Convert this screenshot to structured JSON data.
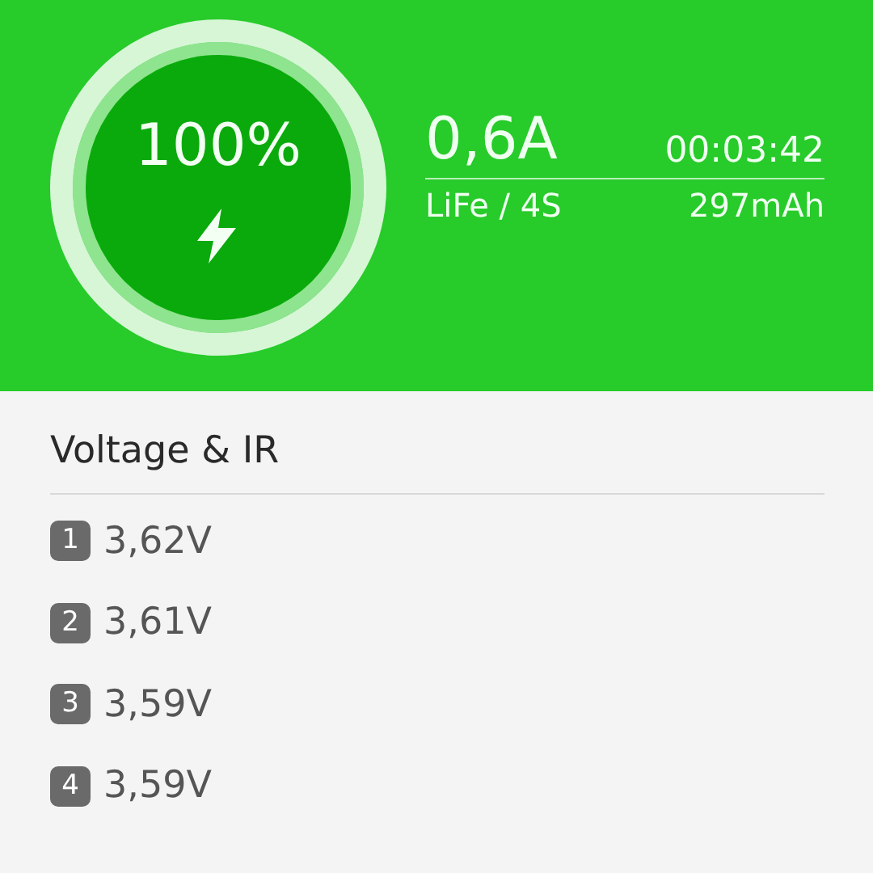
{
  "charge": {
    "percent": "100%",
    "level": 1,
    "current": "0,6A",
    "elapsed": "00:03:42",
    "battery": "LiFe / 4S",
    "capacity": "297mAh"
  },
  "section": {
    "title": "Voltage & IR"
  },
  "cells": [
    {
      "index": "1",
      "voltage": "3,62V"
    },
    {
      "index": "2",
      "voltage": "3,61V"
    },
    {
      "index": "3",
      "voltage": "3,59V"
    },
    {
      "index": "4",
      "voltage": "3,59V"
    }
  ]
}
